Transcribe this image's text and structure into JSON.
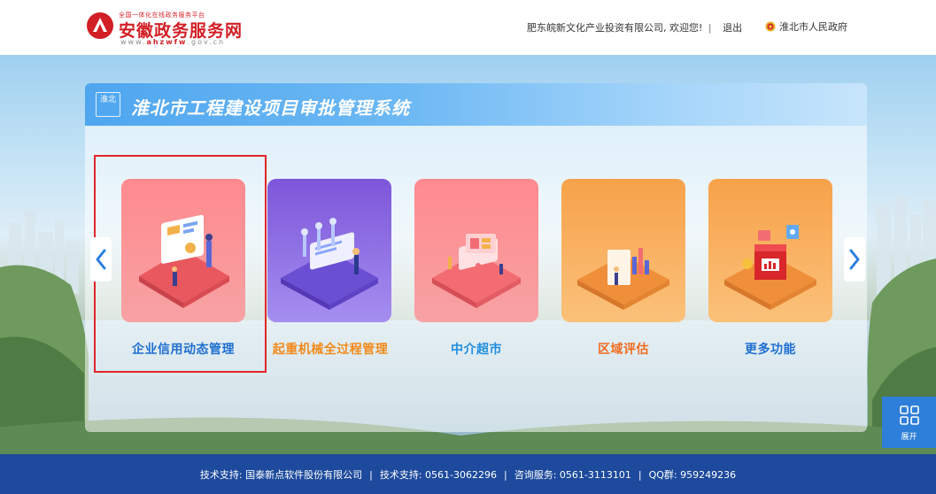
{
  "header": {
    "logo_small": "全国一体化在线政务服务平台",
    "logo_main": "安徽政务服务网",
    "logo_url_prefix": "www.",
    "logo_url_bold": "ahzwfw",
    "logo_url_suffix": ".gov.cn",
    "welcome": "肥东皖新文化产业投资有限公司, 欢迎您!",
    "divider": "|",
    "logout": "退出",
    "gov_link": "淮北市人民政府"
  },
  "panel": {
    "badge": "淮北",
    "title": "淮北市工程建设项目审批管理系统"
  },
  "tiles": [
    {
      "label": "企业信用动态管理",
      "color": "#1f6fd1",
      "selected": true
    },
    {
      "label": "起重机械全过程管理",
      "color": "#f28a1a",
      "selected": false
    },
    {
      "label": "中介超市",
      "color": "#1f8ee0",
      "selected": false
    },
    {
      "label": "区域评估",
      "color": "#f26b1d",
      "selected": false
    },
    {
      "label": "更多功能",
      "color": "#1f6fd1",
      "selected": false
    }
  ],
  "nav": {
    "prev_icon": "chevron-left-icon",
    "next_icon": "chevron-right-icon"
  },
  "expand": {
    "label": "展开",
    "icon": "grid-icon"
  },
  "footer": {
    "tech_support_1": "技术支持: 国泰新点软件股份有限公司",
    "tech_support_2": "技术支持: 0561-3062296",
    "consult": "咨询服务: 0561-3113101",
    "qq": "QQ群: 959249236",
    "separator": "|"
  },
  "colors": {
    "accent": "#2e7fd9",
    "footer": "#1d4a9c",
    "brand_red": "#d21e25",
    "selection": "#e0262b"
  }
}
